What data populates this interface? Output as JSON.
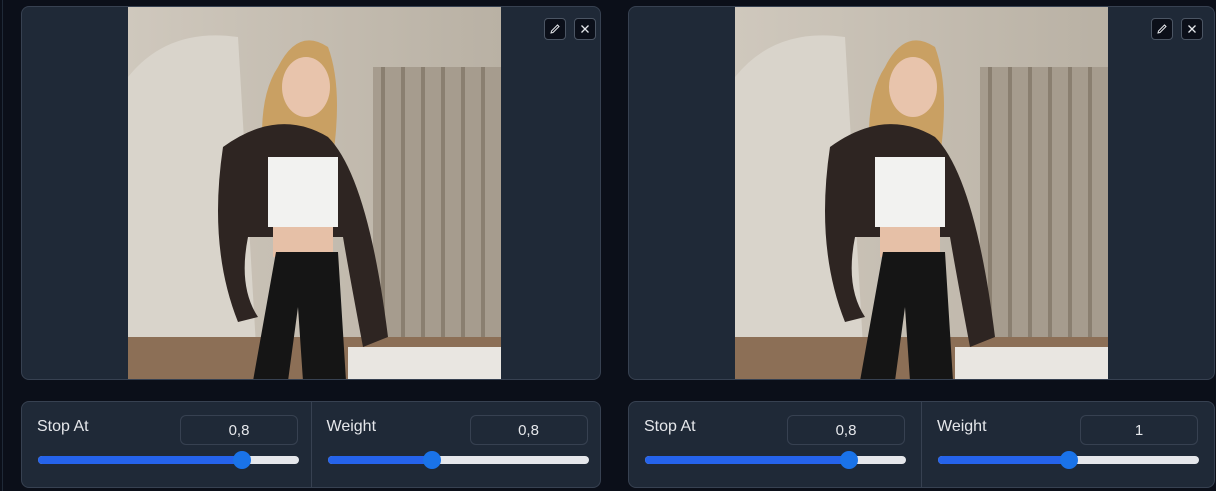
{
  "panels": [
    {
      "image_alt": "Blonde woman in a dark leather jacket, white crop top and black jeans standing in a room",
      "controls": [
        {
          "label": "Stop At",
          "value": "0,8",
          "level": 0.78
        },
        {
          "label": "Weight",
          "value": "0,8",
          "level": 0.4
        }
      ]
    },
    {
      "image_alt": "Blonde woman in a dark leather jacket, white crop top and black jeans standing in a room",
      "controls": [
        {
          "label": "Stop At",
          "value": "0,8",
          "level": 0.78
        },
        {
          "label": "Weight",
          "value": "1",
          "level": 0.5
        }
      ]
    }
  ],
  "icons": {
    "edit": "pencil-icon",
    "close": "close-icon"
  },
  "colors": {
    "panel_bg": "#1f2937",
    "page_bg": "#0b0f19",
    "slider_fill": "#2563eb",
    "slider_thumb": "#1a73e8"
  }
}
